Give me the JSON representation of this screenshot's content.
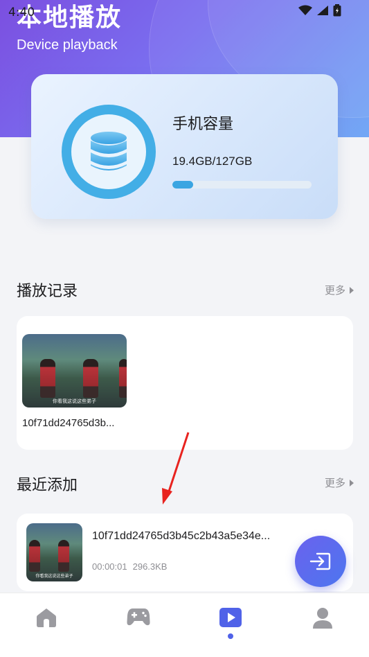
{
  "status_bar": {
    "time": "4:40"
  },
  "header": {
    "title": "本地播放",
    "subtitle": "Device playback"
  },
  "storage": {
    "label": "手机容量",
    "value_text": "19.4GB/127GB",
    "used_fraction": 0.15
  },
  "history": {
    "title": "播放记录",
    "more_label": "更多",
    "items": [
      {
        "name": "10f71dd24765d3b...",
        "subtitle": "你看我这说这些弟子"
      }
    ]
  },
  "recent": {
    "title": "最近添加",
    "more_label": "更多",
    "items": [
      {
        "name": "10f71dd24765d3b45c2b43a5e34e...",
        "duration": "00:00:01",
        "size": "296.3KB",
        "subtitle": "你看我这说这些弟子"
      }
    ]
  },
  "fab": {
    "icon": "import-icon"
  },
  "nav": {
    "items": [
      {
        "icon": "home-icon"
      },
      {
        "icon": "gamepad-icon"
      },
      {
        "icon": "play-icon",
        "active": true
      },
      {
        "icon": "user-icon"
      }
    ]
  },
  "colors": {
    "accent": "#5062e8",
    "header_start": "#7b4fe0",
    "header_end": "#6aa3f5",
    "ring": "#43aee6"
  }
}
